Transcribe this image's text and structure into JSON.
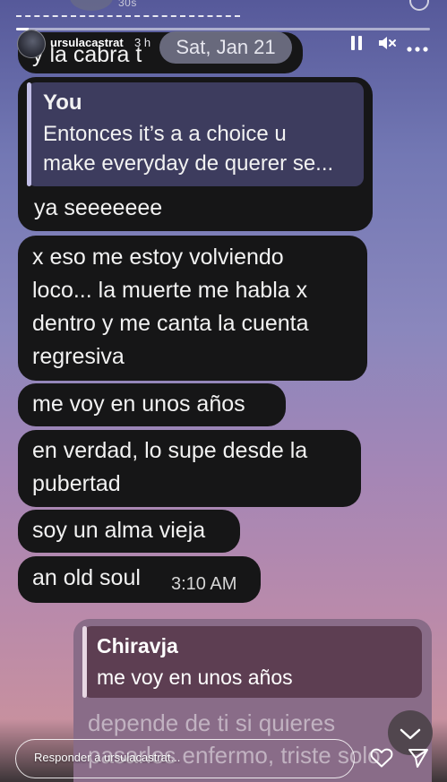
{
  "top": {
    "timer": "30s"
  },
  "story": {
    "username": "ursulacastrat",
    "time_ago": "3 h",
    "date_label": "Sat, Jan 21",
    "progress": 0.03
  },
  "chat": {
    "partial_top": "y la cabra t",
    "reply_you": {
      "author": "You",
      "text_line1": "Entonces it’s a a choice u",
      "text_line2": "make everyday de querer se..."
    },
    "msg1": "ya seeeeeee",
    "msg2_lines": [
      "x eso me estoy volviendo",
      "loco... la muerte me habla x",
      "dentro y me canta la cuenta",
      "regresiva"
    ],
    "msg3": "me voy en unos años",
    "msg4_lines": [
      "en verdad, lo supe desde la",
      "pubertad"
    ],
    "msg5": "soy un alma vieja",
    "msg6": "an old soul",
    "msg6_time": "3:10 AM",
    "reply_chiravja": {
      "author": "Chiravja",
      "text": "me voy en unos años"
    },
    "outgoing_lines": [
      "depende de ti si quieres",
      "pasarlos enfermo, triste solo"
    ]
  },
  "footer": {
    "reply_placeholder": "Responder a ursulacastrat..."
  },
  "colors": {
    "bubble": "#161617",
    "reply_you_bg": "#3d3c5e",
    "reply_you_bar": "#c2bfe8",
    "outgoing_bg": "#896c88",
    "reply_chiravja_bg": "#5d3e52",
    "reply_chiravja_bar": "#e7d7e3"
  },
  "icons": [
    "pause-icon",
    "mute-icon",
    "more-options-icon",
    "chevron-down-icon",
    "heart-icon",
    "send-icon"
  ]
}
